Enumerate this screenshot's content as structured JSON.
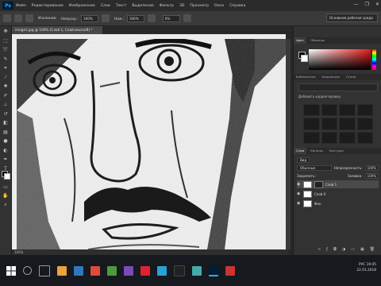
{
  "app": {
    "logo": "Ps"
  },
  "menu": [
    "Файл",
    "Редактирование",
    "Изображение",
    "Слои",
    "Текст",
    "Выделение",
    "Фильтр",
    "3D",
    "Просмотр",
    "Окно",
    "Справка"
  ],
  "window_controls": {
    "minimize": "—",
    "maximize": "❐",
    "close": "✕"
  },
  "options": {
    "mode_label": "Изолинии",
    "opacity_label": "Непрозр.:",
    "opacity_value": "100%",
    "flow_label": "Наж.:",
    "flow_value": "100%",
    "extra_value": "0%"
  },
  "workspace": "Основная рабочая среда",
  "document": {
    "tab": "image1.jpg @ 100% (Слой 1, Слой-маска/8) *",
    "status": "100%"
  },
  "colors": {
    "accent": "#31a8ff",
    "foreground": "#000000",
    "background": "#ffffff"
  },
  "panels": {
    "color_tabs": [
      "Цвет",
      "Образцы"
    ],
    "libraries_tabs": [
      "Библиотеки",
      "Коррекция",
      "Стили"
    ],
    "adjustments_title": "Добавить корректировку",
    "layers_tabs": [
      "Слои",
      "Каналы",
      "Контуры"
    ],
    "layers_kind": "Вид",
    "blend_mode": "Обычные",
    "opacity_label": "Непрозрачность:",
    "opacity_value": "100%",
    "fill_label": "Заливка:",
    "fill_value": "100%",
    "lock_label": "Закрепить:",
    "layers": [
      {
        "name": "Слой 1",
        "mask": true
      },
      {
        "name": "Слой 0",
        "mask": false
      },
      {
        "name": "Фон",
        "mask": false
      }
    ]
  },
  "taskbar": {
    "time": "19:45",
    "date": "22.01.2018",
    "lang": "РУС"
  }
}
